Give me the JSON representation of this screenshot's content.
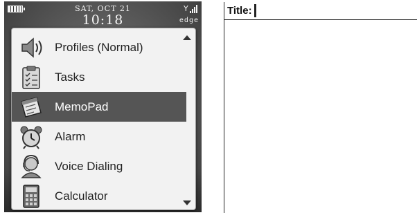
{
  "status_bar": {
    "date": "SAT, OCT 21",
    "time": "10:18",
    "network": "edge",
    "battery_icon": "battery-icon",
    "signal_icon": "signal-strength-icon"
  },
  "menu": {
    "items": [
      {
        "label": "Profiles (Normal)",
        "icon": "speaker-icon",
        "selected": false
      },
      {
        "label": "Tasks",
        "icon": "clipboard-icon",
        "selected": false
      },
      {
        "label": "MemoPad",
        "icon": "notepad-icon",
        "selected": true
      },
      {
        "label": "Alarm",
        "icon": "alarm-clock-icon",
        "selected": false
      },
      {
        "label": "Voice Dialing",
        "icon": "headset-person-icon",
        "selected": false
      },
      {
        "label": "Calculator",
        "icon": "calculator-icon",
        "selected": false
      }
    ],
    "scroll_up_icon": "scroll-up-arrow-icon",
    "scroll_down_icon": "scroll-down-arrow-icon"
  },
  "memo": {
    "title_label": "Title:",
    "title_value": ""
  },
  "colors": {
    "selected_bg": "#555555",
    "menu_bg": "#f2f2f2",
    "memo_bg": "#ffffff"
  }
}
